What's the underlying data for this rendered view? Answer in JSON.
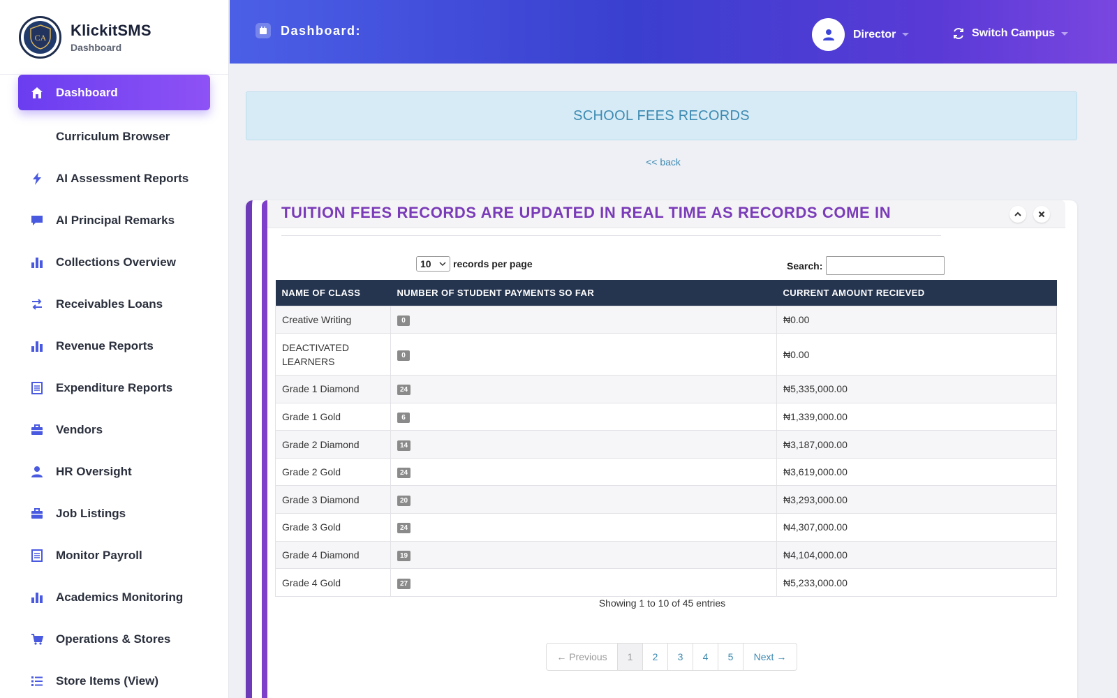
{
  "brand": {
    "name": "KlickitSMS",
    "subtitle": "Dashboard",
    "logo_text": "CA"
  },
  "header": {
    "title": "Dashboard:",
    "user_name": "Director",
    "switch_label": "Switch Campus"
  },
  "sidebar": {
    "items": [
      {
        "label": "Dashboard",
        "icon": "home-icon",
        "active": true
      },
      {
        "label": "Curriculum Browser",
        "icon": "",
        "active": false
      },
      {
        "label": "AI Assessment Reports",
        "icon": "bolt-icon",
        "active": false
      },
      {
        "label": "AI Principal Remarks",
        "icon": "comment-icon",
        "active": false
      },
      {
        "label": "Collections Overview",
        "icon": "bar-chart-icon",
        "active": false
      },
      {
        "label": "Receivables Loans",
        "icon": "exchange-icon",
        "active": false
      },
      {
        "label": "Revenue Reports",
        "icon": "bar-chart-icon",
        "active": false
      },
      {
        "label": "Expenditure Reports",
        "icon": "list-doc-icon",
        "active": false
      },
      {
        "label": "Vendors",
        "icon": "briefcase-icon",
        "active": false
      },
      {
        "label": "HR Oversight",
        "icon": "user-icon",
        "active": false
      },
      {
        "label": "Job Listings",
        "icon": "briefcase-icon",
        "active": false
      },
      {
        "label": "Monitor Payroll",
        "icon": "list-doc-icon",
        "active": false
      },
      {
        "label": "Academics Monitoring",
        "icon": "bar-chart-icon",
        "active": false
      },
      {
        "label": "Operations & Stores",
        "icon": "cart-icon",
        "active": false
      },
      {
        "label": "Store Items (View)",
        "icon": "list-icon",
        "active": false
      }
    ]
  },
  "main": {
    "banner": "SCHOOL FEES RECORDS",
    "back_link": "<< back",
    "panel_title": "TUITION FEES RECORDS ARE UPDATED IN REAL TIME AS RECORDS COME IN",
    "page_length": {
      "value": "10",
      "label": "records per page"
    },
    "search": {
      "label": "Search:",
      "value": "",
      "placeholder": ""
    },
    "table": {
      "columns": [
        "NAME OF CLASS",
        "NUMBER OF STUDENT PAYMENTS SO FAR",
        "CURRENT AMOUNT RECIEVED"
      ],
      "rows": [
        {
          "name": "Creative Writing",
          "payments": "0",
          "amount": "₦0.00"
        },
        {
          "name": "DEACTIVATED LEARNERS",
          "payments": "0",
          "amount": "₦0.00"
        },
        {
          "name": "Grade 1 Diamond",
          "payments": "24",
          "amount": "₦5,335,000.00"
        },
        {
          "name": "Grade 1 Gold",
          "payments": "6",
          "amount": "₦1,339,000.00"
        },
        {
          "name": "Grade 2 Diamond",
          "payments": "14",
          "amount": "₦3,187,000.00"
        },
        {
          "name": "Grade 2 Gold",
          "payments": "24",
          "amount": "₦3,619,000.00"
        },
        {
          "name": "Grade 3 Diamond",
          "payments": "20",
          "amount": "₦3,293,000.00"
        },
        {
          "name": "Grade 3 Gold",
          "payments": "24",
          "amount": "₦4,307,000.00"
        },
        {
          "name": "Grade 4 Diamond",
          "payments": "19",
          "amount": "₦4,104,000.00"
        },
        {
          "name": "Grade 4 Gold",
          "payments": "27",
          "amount": "₦5,233,000.00"
        }
      ]
    },
    "info": "Showing 1 to 10 of 45 entries",
    "pagination": {
      "prev": "← Previous",
      "pages": [
        "1",
        "2",
        "3",
        "4",
        "5"
      ],
      "current": "1",
      "next": "Next →"
    }
  },
  "colors": {
    "accent": "#7e3fcb",
    "header_gradient_start": "#4b5fe6",
    "header_gradient_end": "#7a46e0",
    "table_header": "#253550",
    "banner_bg": "#d6ebf5",
    "banner_text": "#3d8ab2"
  }
}
